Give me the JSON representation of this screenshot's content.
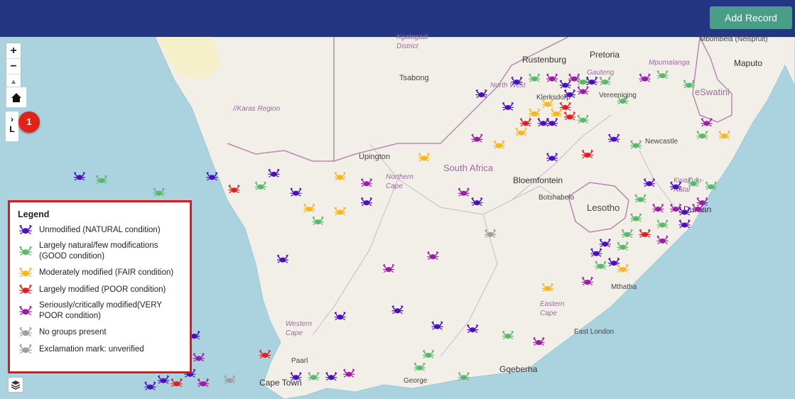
{
  "header": {
    "add_record_label": "Add Record"
  },
  "controls": {
    "zoom_in": "+",
    "zoom_out": "−",
    "reset_bearing": "▲",
    "layer_toggle": ">\nL",
    "notification_count": "1"
  },
  "legend": {
    "title": "Legend",
    "items": [
      {
        "label": "Unmodified (NATURAL condition)",
        "color": "#4b0fc0"
      },
      {
        "label": "Largely natural/few modifications (GOOD condition)",
        "color": "#5bb86a"
      },
      {
        "label": "Moderately modified (FAIR condition)",
        "color": "#f7b51e"
      },
      {
        "label": "Largely modified (POOR condition)",
        "color": "#e01f1f"
      },
      {
        "label": "Seriously/critically modified(VERY POOR condition)",
        "color": "#9b1ca5"
      },
      {
        "label": "No groups present",
        "color": "#a0a0a0"
      },
      {
        "label": "Exclamation mark: unverified",
        "color": "#9e9e9e"
      }
    ]
  },
  "map": {
    "colors": {
      "sea": "#aad3df",
      "land": "#f2efe9",
      "lesotho": "#f2efe9",
      "border": "#b58aaf",
      "desert": "#f5f0c9"
    },
    "places": [
      {
        "name": "Rustenburg",
        "kind": "city"
      },
      {
        "name": "Pretoria",
        "kind": "city"
      },
      {
        "name": "Mbombela (Nelspruit)",
        "kind": "place"
      },
      {
        "name": "Maputo",
        "kind": "city"
      },
      {
        "name": "Tsabong",
        "kind": "place"
      },
      {
        "name": "North West",
        "kind": "region"
      },
      {
        "name": "Klerksdorp",
        "kind": "place"
      },
      {
        "name": "Vereeniging",
        "kind": "place"
      },
      {
        "name": "Mpumalanga",
        "kind": "region"
      },
      {
        "name": "eSwatini",
        "kind": "nation"
      },
      {
        "name": "Gauteng",
        "kind": "region"
      },
      {
        "name": "//Karas Region",
        "kind": "region"
      },
      {
        "name": "Upington",
        "kind": "place"
      },
      {
        "name": "South Africa",
        "kind": "country"
      },
      {
        "name": "Northern Cape",
        "kind": "region"
      },
      {
        "name": "Bloemfontein",
        "kind": "city"
      },
      {
        "name": "Botshabelo",
        "kind": "place"
      },
      {
        "name": "Newcastle",
        "kind": "place"
      },
      {
        "name": "KwaZulu-Natal",
        "kind": "region"
      },
      {
        "name": "Lesotho",
        "kind": "nation"
      },
      {
        "name": "Durban",
        "kind": "city"
      },
      {
        "name": "Mthatha",
        "kind": "place"
      },
      {
        "name": "Eastern Cape",
        "kind": "region"
      },
      {
        "name": "Western Cape",
        "kind": "region"
      },
      {
        "name": "East London",
        "kind": "place"
      },
      {
        "name": "Paarl",
        "kind": "place"
      },
      {
        "name": "Cape Town",
        "kind": "city"
      },
      {
        "name": "George",
        "kind": "place"
      },
      {
        "name": "Gqeberha",
        "kind": "city"
      },
      {
        "name": "Kgalagadi District",
        "kind": "region"
      }
    ],
    "markers": [
      {
        "lon": 27.2,
        "lat": -25.6,
        "cond": "natural"
      },
      {
        "lon": 27.6,
        "lat": -25.5,
        "cond": "good"
      },
      {
        "lon": 28.0,
        "lat": -25.5,
        "cond": "very_poor"
      },
      {
        "lon": 28.3,
        "lat": -25.7,
        "cond": "natural"
      },
      {
        "lon": 28.5,
        "lat": -25.5,
        "cond": "very_poor"
      },
      {
        "lon": 28.7,
        "lat": -25.6,
        "cond": "good"
      },
      {
        "lon": 28.9,
        "lat": -25.6,
        "cond": "natural"
      },
      {
        "lon": 29.2,
        "lat": -25.6,
        "cond": "good"
      },
      {
        "lon": 28.4,
        "lat": -26.0,
        "cond": "natural"
      },
      {
        "lon": 28.7,
        "lat": -25.9,
        "cond": "very_poor"
      },
      {
        "lon": 30.1,
        "lat": -25.5,
        "cond": "very_poor"
      },
      {
        "lon": 30.5,
        "lat": -25.4,
        "cond": "good"
      },
      {
        "lon": 31.1,
        "lat": -25.7,
        "cond": "good"
      },
      {
        "lon": 26.4,
        "lat": -26.0,
        "cond": "natural"
      },
      {
        "lon": 27.0,
        "lat": -26.4,
        "cond": "natural"
      },
      {
        "lon": 27.9,
        "lat": -26.3,
        "cond": "fair"
      },
      {
        "lon": 28.3,
        "lat": -26.4,
        "cond": "poor"
      },
      {
        "lon": 29.6,
        "lat": -26.2,
        "cond": "good"
      },
      {
        "lon": 27.6,
        "lat": -26.6,
        "cond": "fair"
      },
      {
        "lon": 28.1,
        "lat": -26.6,
        "cond": "fair"
      },
      {
        "lon": 28.4,
        "lat": -26.7,
        "cond": "poor"
      },
      {
        "lon": 28.7,
        "lat": -26.8,
        "cond": "good"
      },
      {
        "lon": 27.4,
        "lat": -26.9,
        "cond": "poor"
      },
      {
        "lon": 27.8,
        "lat": -26.9,
        "cond": "natural"
      },
      {
        "lon": 28.0,
        "lat": -26.9,
        "cond": "natural"
      },
      {
        "lon": 27.3,
        "lat": -27.2,
        "cond": "fair"
      },
      {
        "lon": 26.3,
        "lat": -27.4,
        "cond": "very_poor"
      },
      {
        "lon": 26.8,
        "lat": -27.6,
        "cond": "fair"
      },
      {
        "lon": 29.4,
        "lat": -27.4,
        "cond": "natural"
      },
      {
        "lon": 29.9,
        "lat": -27.6,
        "cond": "good"
      },
      {
        "lon": 31.5,
        "lat": -26.9,
        "cond": "very_poor"
      },
      {
        "lon": 31.4,
        "lat": -27.3,
        "cond": "good"
      },
      {
        "lon": 31.9,
        "lat": -27.3,
        "cond": "fair"
      },
      {
        "lon": 28.0,
        "lat": -28.0,
        "cond": "natural"
      },
      {
        "lon": 28.8,
        "lat": -27.9,
        "cond": "poor"
      },
      {
        "lon": 25.1,
        "lat": -28.0,
        "cond": "fair"
      },
      {
        "lon": 17.3,
        "lat": -28.6,
        "cond": "natural"
      },
      {
        "lon": 17.8,
        "lat": -28.7,
        "cond": "good"
      },
      {
        "lon": 19.1,
        "lat": -29.1,
        "cond": "good"
      },
      {
        "lon": 20.3,
        "lat": -28.6,
        "cond": "natural"
      },
      {
        "lon": 20.8,
        "lat": -29.0,
        "cond": "poor"
      },
      {
        "lon": 21.4,
        "lat": -28.9,
        "cond": "good"
      },
      {
        "lon": 21.7,
        "lat": -28.5,
        "cond": "natural"
      },
      {
        "lon": 22.2,
        "lat": -29.1,
        "cond": "natural"
      },
      {
        "lon": 23.2,
        "lat": -28.6,
        "cond": "fair"
      },
      {
        "lon": 23.8,
        "lat": -28.8,
        "cond": "very_poor"
      },
      {
        "lon": 26.0,
        "lat": -29.1,
        "cond": "very_poor"
      },
      {
        "lon": 26.3,
        "lat": -29.4,
        "cond": "natural"
      },
      {
        "lon": 22.5,
        "lat": -29.6,
        "cond": "fair"
      },
      {
        "lon": 23.2,
        "lat": -29.7,
        "cond": "fair"
      },
      {
        "lon": 23.8,
        "lat": -29.4,
        "cond": "natural"
      },
      {
        "lon": 22.7,
        "lat": -30.0,
        "cond": "good"
      },
      {
        "lon": 26.6,
        "lat": -30.4,
        "cond": "unverified"
      },
      {
        "lon": 30.2,
        "lat": -28.8,
        "cond": "natural"
      },
      {
        "lon": 30.8,
        "lat": -28.9,
        "cond": "natural"
      },
      {
        "lon": 31.2,
        "lat": -28.8,
        "cond": "good"
      },
      {
        "lon": 31.6,
        "lat": -28.9,
        "cond": "good"
      },
      {
        "lon": 30.0,
        "lat": -29.3,
        "cond": "good"
      },
      {
        "lon": 30.4,
        "lat": -29.6,
        "cond": "very_poor"
      },
      {
        "lon": 30.8,
        "lat": -29.6,
        "cond": "very_poor"
      },
      {
        "lon": 31.0,
        "lat": -29.7,
        "cond": "natural"
      },
      {
        "lon": 31.3,
        "lat": -29.6,
        "cond": "very_poor"
      },
      {
        "lon": 31.4,
        "lat": -29.4,
        "cond": "very_poor"
      },
      {
        "lon": 29.9,
        "lat": -29.9,
        "cond": "good"
      },
      {
        "lon": 30.5,
        "lat": -30.1,
        "cond": "good"
      },
      {
        "lon": 31.0,
        "lat": -30.1,
        "cond": "natural"
      },
      {
        "lon": 29.7,
        "lat": -30.4,
        "cond": "good"
      },
      {
        "lon": 30.1,
        "lat": -30.4,
        "cond": "poor"
      },
      {
        "lon": 30.5,
        "lat": -30.6,
        "cond": "very_poor"
      },
      {
        "lon": 29.2,
        "lat": -30.7,
        "cond": "natural"
      },
      {
        "lon": 29.6,
        "lat": -30.8,
        "cond": "good"
      },
      {
        "lon": 29.0,
        "lat": -31.0,
        "cond": "natural"
      },
      {
        "lon": 29.4,
        "lat": -31.3,
        "cond": "natural"
      },
      {
        "lon": 29.1,
        "lat": -31.4,
        "cond": "good"
      },
      {
        "lon": 29.6,
        "lat": -31.5,
        "cond": "fair"
      },
      {
        "lon": 28.8,
        "lat": -31.9,
        "cond": "very_poor"
      },
      {
        "lon": 27.9,
        "lat": -32.1,
        "cond": "fair"
      },
      {
        "lon": 25.3,
        "lat": -31.1,
        "cond": "very_poor"
      },
      {
        "lon": 24.3,
        "lat": -31.5,
        "cond": "very_poor"
      },
      {
        "lon": 19.3,
        "lat": -31.0,
        "cond": "good"
      },
      {
        "lon": 21.9,
        "lat": -31.2,
        "cond": "natural"
      },
      {
        "lon": 23.2,
        "lat": -33.0,
        "cond": "natural"
      },
      {
        "lon": 24.5,
        "lat": -32.8,
        "cond": "natural"
      },
      {
        "lon": 25.4,
        "lat": -33.3,
        "cond": "natural"
      },
      {
        "lon": 26.2,
        "lat": -33.4,
        "cond": "natural"
      },
      {
        "lon": 27.0,
        "lat": -33.6,
        "cond": "good"
      },
      {
        "lon": 27.7,
        "lat": -33.8,
        "cond": "very_poor"
      },
      {
        "lon": 19.9,
        "lat": -33.6,
        "cond": "natural"
      },
      {
        "lon": 20.0,
        "lat": -34.3,
        "cond": "very_poor"
      },
      {
        "lon": 21.5,
        "lat": -34.2,
        "cond": "poor"
      },
      {
        "lon": 19.8,
        "lat": -34.8,
        "cond": "natural"
      },
      {
        "lon": 19.2,
        "lat": -35.0,
        "cond": "natural"
      },
      {
        "lon": 19.5,
        "lat": -35.1,
        "cond": "poor"
      },
      {
        "lon": 20.1,
        "lat": -35.1,
        "cond": "very_poor"
      },
      {
        "lon": 20.7,
        "lat": -35.0,
        "cond": "unverified"
      },
      {
        "lon": 22.2,
        "lat": -34.9,
        "cond": "natural"
      },
      {
        "lon": 22.6,
        "lat": -34.9,
        "cond": "good"
      },
      {
        "lon": 23.0,
        "lat": -34.9,
        "cond": "natural"
      },
      {
        "lon": 23.4,
        "lat": -34.8,
        "cond": "very_poor"
      },
      {
        "lon": 25.0,
        "lat": -34.6,
        "cond": "good"
      },
      {
        "lon": 26.0,
        "lat": -34.9,
        "cond": "good"
      },
      {
        "lon": 18.9,
        "lat": -35.2,
        "cond": "natural"
      },
      {
        "lon": 25.2,
        "lat": -34.2,
        "cond": "good"
      }
    ],
    "condition_colors": {
      "natural": "#4b0fc0",
      "good": "#5bb86a",
      "fair": "#f7b51e",
      "poor": "#e01f1f",
      "very_poor": "#9b1ca5",
      "unverified": "#9e9e9e"
    }
  }
}
